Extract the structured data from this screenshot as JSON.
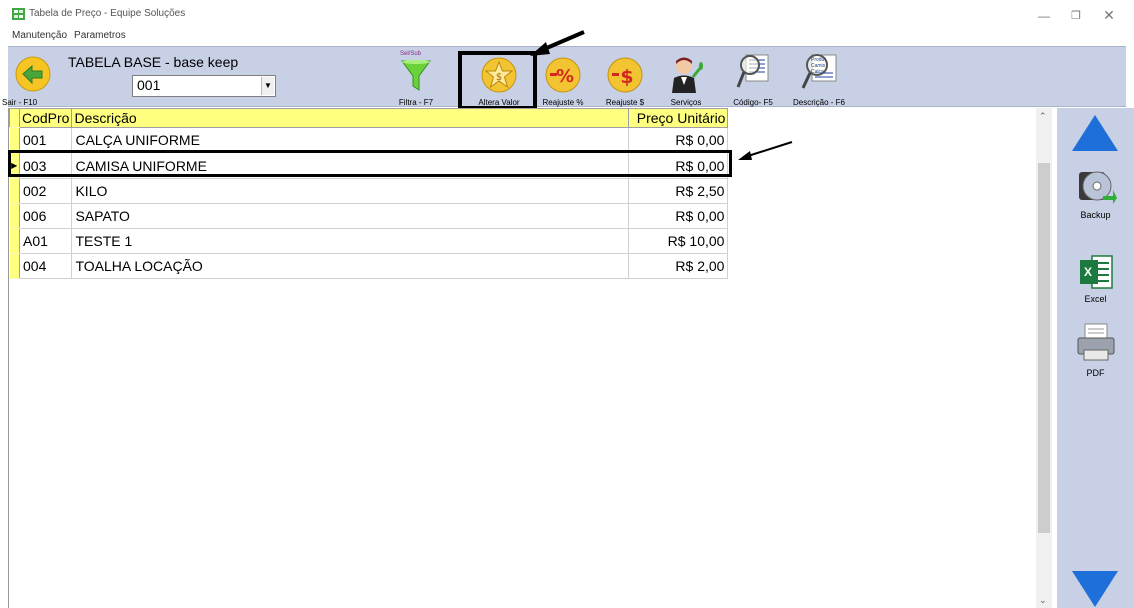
{
  "window": {
    "title": "Tabela de Preço - Equipe Soluções",
    "controls": {
      "minimize": "—",
      "maximize": "❐",
      "close": "✕"
    }
  },
  "menu": [
    "Manutenção",
    "Parametros"
  ],
  "toolbar": {
    "exit_label": "Sair - F10",
    "table_title": "TABELA BASE - base keep",
    "table_select": "001",
    "filter_label": "Filtra - F7",
    "change_value_label": "Altera Valor",
    "adjust_percent_label": "Reajuste %",
    "adjust_money_label": "Reajuste $",
    "services_label": "Serviços",
    "code_label": "Código- F5",
    "description_label": "Descrição - F6",
    "filter_badge": "Sel/Sub",
    "desc_magnifier_text": "Produt Camis Calça"
  },
  "grid": {
    "headers": {
      "code": "CodPro",
      "description": "Descrição",
      "price": "Preço Unitário"
    },
    "rows": [
      {
        "code": "001",
        "description": "CALÇA UNIFORME",
        "price": "R$ 0,00"
      },
      {
        "code": "003",
        "description": "CAMISA UNIFORME",
        "price": "R$ 0,00"
      },
      {
        "code": "002",
        "description": "KILO",
        "price": "R$ 2,50"
      },
      {
        "code": "006",
        "description": "SAPATO",
        "price": "R$ 0,00"
      },
      {
        "code": "A01",
        "description": "TESTE 1",
        "price": "R$ 10,00"
      },
      {
        "code": "004",
        "description": "TOALHA LOCAÇÃO",
        "price": "R$ 2,00"
      }
    ],
    "current_row_marker": "▶"
  },
  "side": {
    "backup_label": "Backup",
    "excel_label": "Excel",
    "pdf_label": "PDF",
    "excel_glyph": "X"
  },
  "colors": {
    "toolbar_bg": "#c7d0e5",
    "header_bg": "#ffff80",
    "arrow_blue": "#1e6fd9"
  }
}
